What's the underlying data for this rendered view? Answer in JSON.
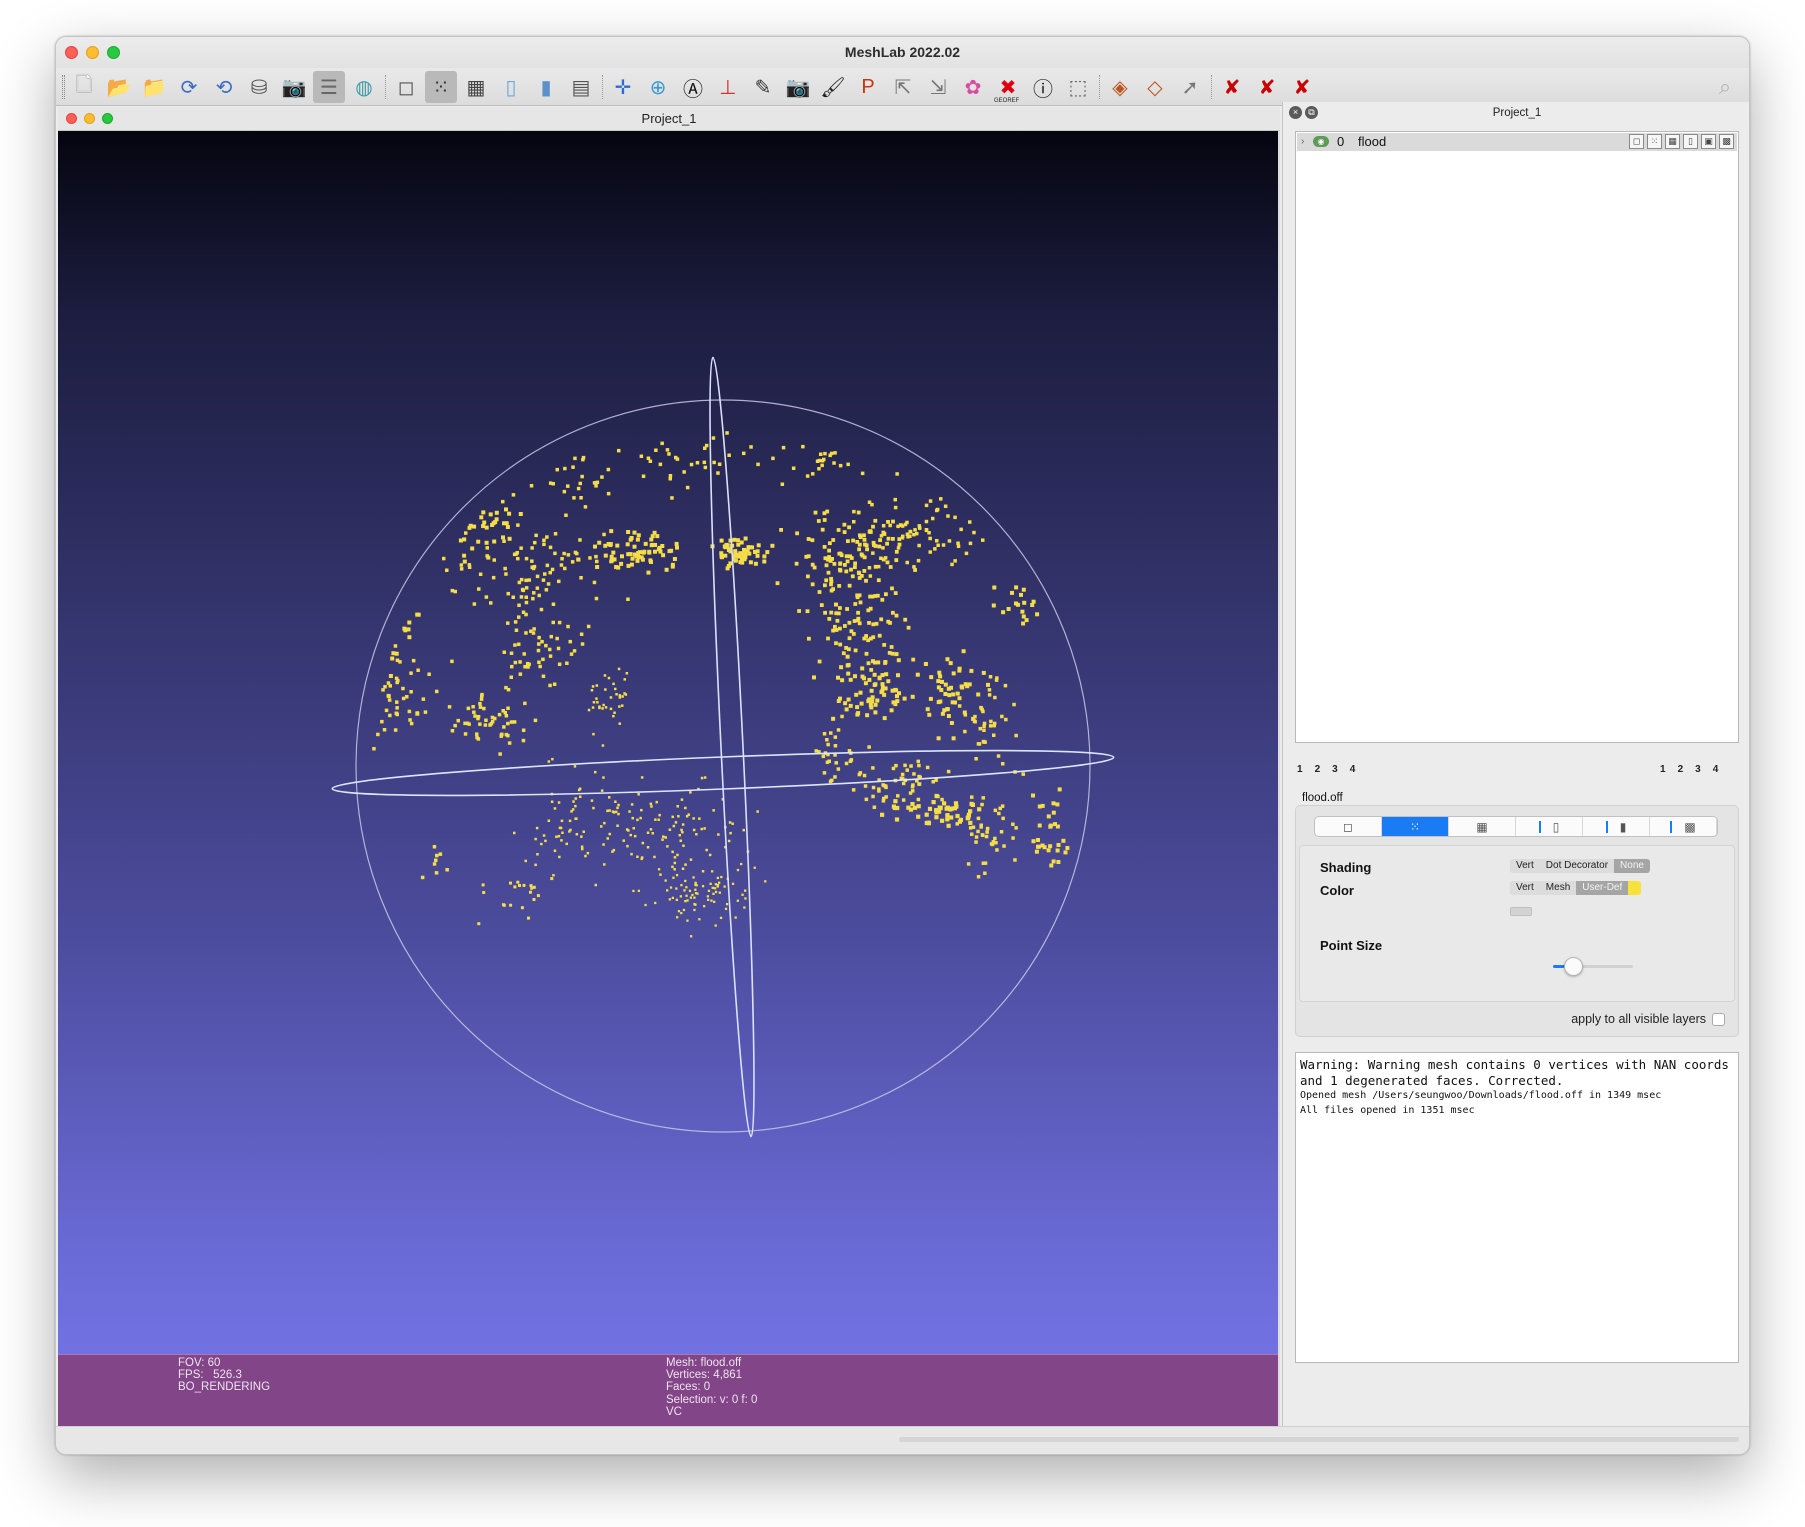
{
  "app": {
    "title": "MeshLab 2022.02"
  },
  "toolbar": {
    "buttons": [
      {
        "name": "new-project-icon",
        "glyph": "🗋"
      },
      {
        "name": "open-project-icon",
        "glyph": "📂"
      },
      {
        "name": "import-mesh-icon",
        "glyph": "📁"
      },
      {
        "name": "reload-icon",
        "glyph": "⟳"
      },
      {
        "name": "reload-all-icon",
        "glyph": "⟲"
      },
      {
        "name": "export-mesh-icon",
        "glyph": "⛁"
      },
      {
        "name": "snapshot-icon",
        "glyph": "📷"
      },
      {
        "name": "layer-dialog-icon",
        "glyph": "☰"
      },
      {
        "name": "raster-layer-icon",
        "glyph": "◍"
      },
      {
        "name": "bbox-render-icon",
        "glyph": "◻"
      },
      {
        "name": "points-render-icon",
        "glyph": "⁙"
      },
      {
        "name": "wireframe-render-icon",
        "glyph": "▦"
      },
      {
        "name": "smooth-render-icon",
        "glyph": "▯"
      },
      {
        "name": "flat-render-icon",
        "glyph": "▮"
      },
      {
        "name": "show-layers-icon",
        "glyph": "▤"
      },
      {
        "name": "axis-align-icon",
        "glyph": "✛"
      },
      {
        "name": "trackball-icon",
        "glyph": "⊕"
      },
      {
        "name": "measure-icon",
        "glyph": "Ⓐ"
      },
      {
        "name": "axes-icon",
        "glyph": "⊥"
      },
      {
        "name": "paint-align-icon",
        "glyph": "✎"
      },
      {
        "name": "raster-align-icon",
        "glyph": "📷"
      },
      {
        "name": "paint-brush-icon",
        "glyph": "🖌"
      },
      {
        "name": "pickpoints-icon",
        "glyph": "P"
      },
      {
        "name": "select-vertices-icon",
        "glyph": "⇱"
      },
      {
        "name": "select-connected-icon",
        "glyph": "⇲"
      },
      {
        "name": "sample-mesh-icon",
        "glyph": "✿"
      },
      {
        "name": "georef-icon",
        "glyph": "✖"
      },
      {
        "name": "info-icon",
        "glyph": "ⓘ"
      },
      {
        "name": "select-faces-icon",
        "glyph": "⬚"
      },
      {
        "name": "select-area-icon",
        "glyph": "◈"
      },
      {
        "name": "select-deselect-icon",
        "glyph": "◇"
      },
      {
        "name": "select-arrow-icon",
        "glyph": "➚"
      },
      {
        "name": "delete-vertices-icon",
        "glyph": "✘"
      },
      {
        "name": "delete-faces-icon",
        "glyph": "✘"
      },
      {
        "name": "delete-both-icon",
        "glyph": "✘"
      }
    ],
    "search_icon": "⌕",
    "georef_label": "GEOREF"
  },
  "viewer": {
    "window_title": "Project_1",
    "bg_top": "#050510",
    "bg_bottom": "#7676ec",
    "point_color": "#f4dd46",
    "info_left": [
      "FOV: 60",
      "FPS:   526.3",
      "BO_RENDERING"
    ],
    "info_right": [
      "Mesh: flood.off",
      "Vertices: 4,861",
      "Faces: 0",
      "Selection: v: 0 f: 0",
      "VC"
    ]
  },
  "dock": {
    "title": "Project_1",
    "layer": {
      "index": "0",
      "name": "flood",
      "icons": [
        "◻",
        "⁙",
        "▦",
        "▯",
        "▣",
        "▩"
      ]
    },
    "pages_left": [
      "1",
      "2",
      "3",
      "4"
    ],
    "pages_right": [
      "1",
      "2",
      "3",
      "4"
    ],
    "file_label": "flood.off",
    "decorators": {
      "tabs": [
        "◻",
        "⁙",
        "▦",
        "▯",
        "▮",
        "▩"
      ],
      "shading_label": "Shading",
      "shading_options": [
        "Vert",
        "Dot Decorator",
        "None"
      ],
      "color_label": "Color",
      "color_options": [
        "Vert",
        "Mesh",
        "User-Def"
      ],
      "user_color": "#f7e23c",
      "point_size_label": "Point Size",
      "point_size_level": 0.25,
      "apply_label": "apply to all visible layers"
    },
    "log": {
      "big": [
        "Warning: Warning mesh contains 0 vertices with NAN coords and 1 degenerated faces. Corrected."
      ],
      "small": [
        "Opened mesh /Users/seungwoo/Downloads/flood.off in 1349 msec",
        "All files opened in 1351 msec"
      ]
    }
  }
}
